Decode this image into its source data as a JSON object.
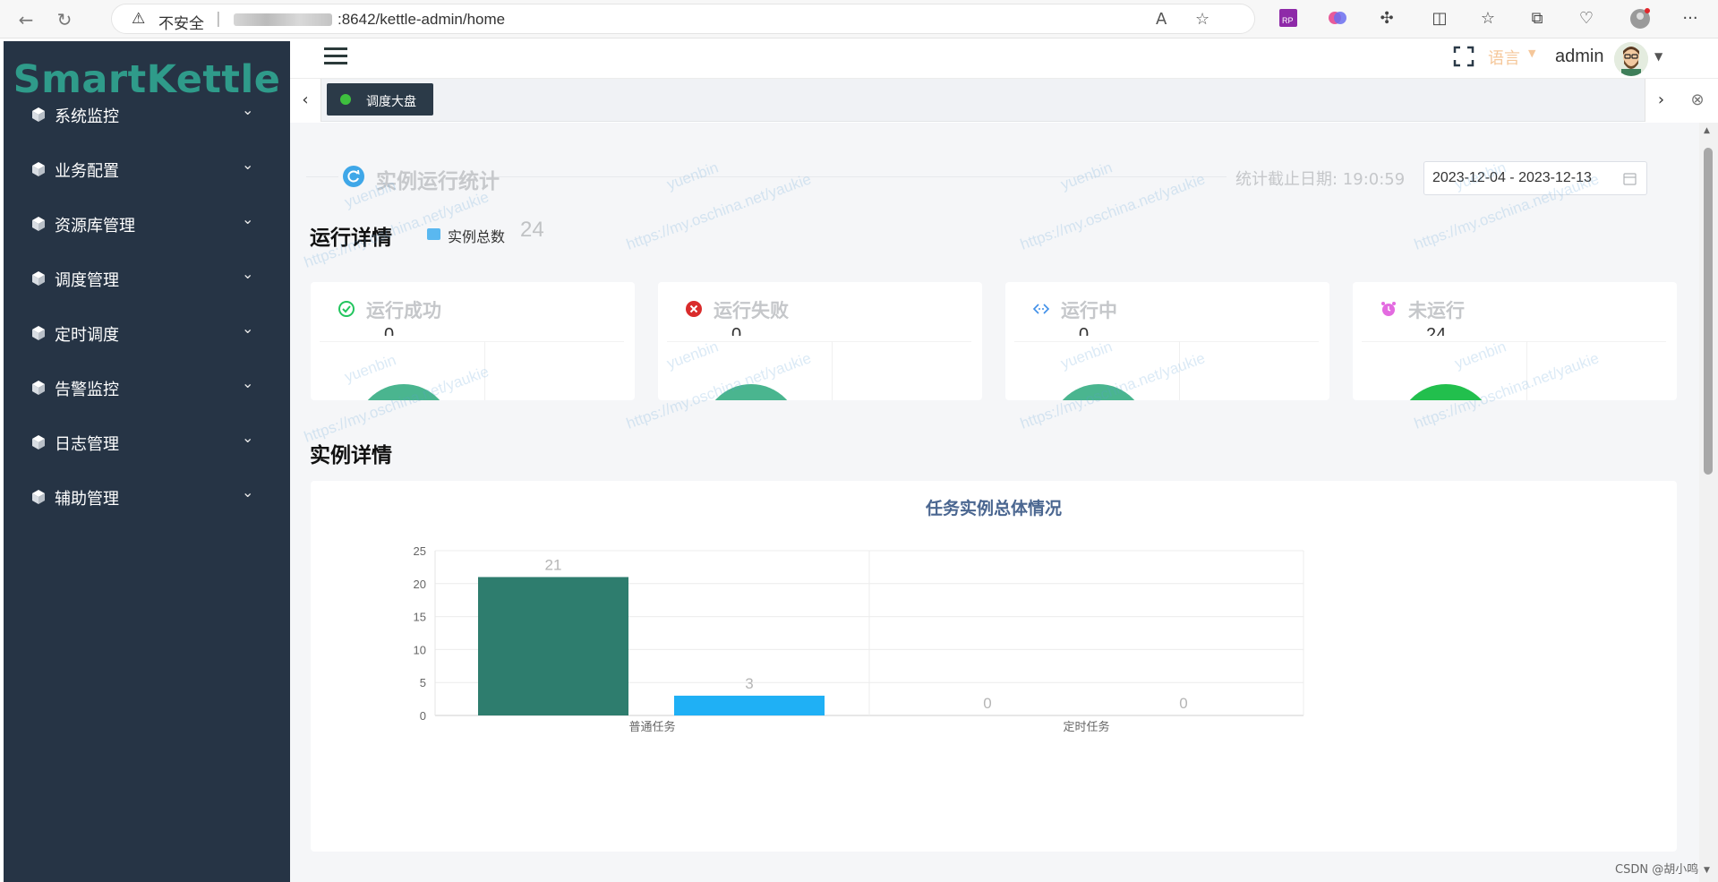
{
  "browser": {
    "insecure_label": "不安全",
    "url": ":8642/kettle-admin/home"
  },
  "sidebar": {
    "brand": "SmartKettle",
    "items": [
      {
        "label": "系统监控"
      },
      {
        "label": "业务配置"
      },
      {
        "label": "资源库管理"
      },
      {
        "label": "调度管理"
      },
      {
        "label": "定时调度"
      },
      {
        "label": "告警监控"
      },
      {
        "label": "日志管理"
      },
      {
        "label": "辅助管理"
      }
    ]
  },
  "header": {
    "language": "语言",
    "username": "admin"
  },
  "tags": {
    "active_tag": "调度大盘"
  },
  "stats": {
    "section_title": "实例运行统计",
    "deadline_label": "统计截止日期: 19:0:59",
    "date_range": "2023-12-04 - 2023-12-13",
    "run_details_title": "运行详情",
    "total_label": "实例总数",
    "total_value": "24",
    "cards": [
      {
        "title": "运行成功",
        "value": "0",
        "color": "#22c55e"
      },
      {
        "title": "运行失败",
        "value": "0",
        "color": "#d92b2b"
      },
      {
        "title": "运行中",
        "value": "0",
        "color": "#3f8fe8"
      },
      {
        "title": "未运行",
        "value": "24",
        "color": "#e36be0"
      }
    ]
  },
  "instance_detail_title": "实例详情",
  "chart_data": {
    "type": "bar",
    "title": "任务实例总体情况",
    "categories": [
      "普通任务",
      "定时任务"
    ],
    "series": [
      {
        "values": [
          21,
          0
        ],
        "color": "#2e7d6e"
      },
      {
        "values": [
          3,
          0
        ],
        "color": "#1fb0f5"
      }
    ],
    "ylim": [
      0,
      25
    ],
    "yticks": [
      0,
      5,
      10,
      15,
      20,
      25
    ],
    "grid": true
  },
  "watermark": {
    "author": "yuenbin",
    "url": "https://my.oschina.net/yaukie"
  },
  "footer": {
    "credit": "CSDN @胡小鸣"
  }
}
